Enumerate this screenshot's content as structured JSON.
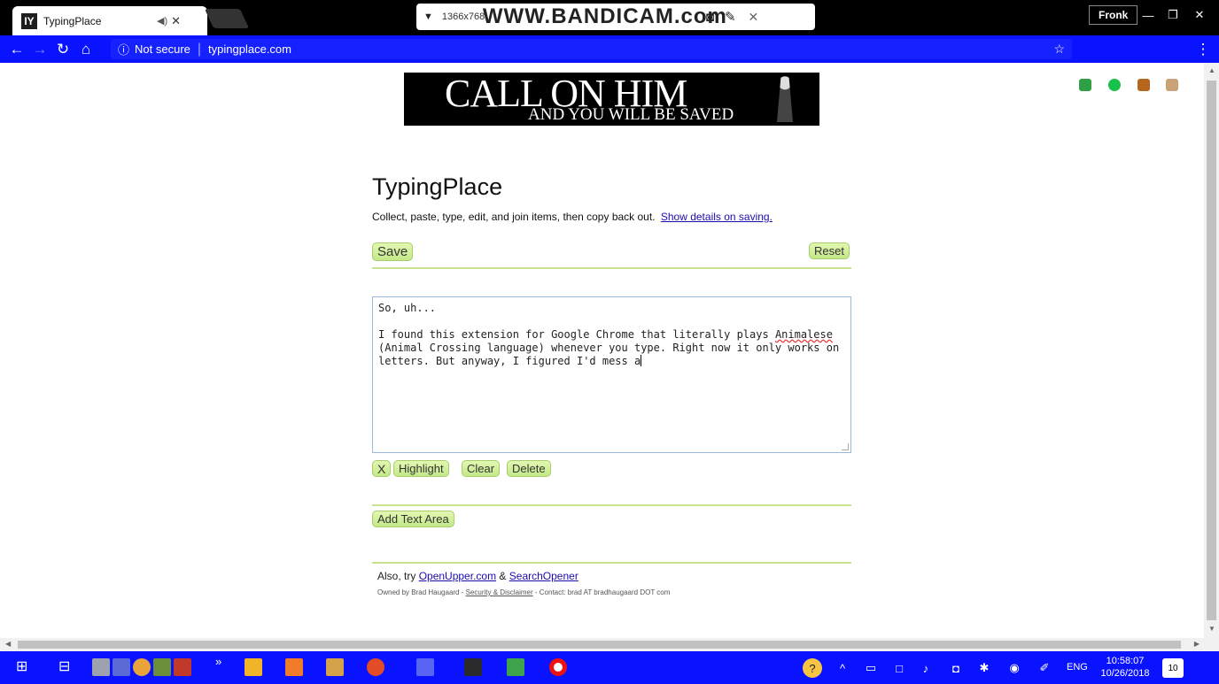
{
  "browser": {
    "tab_title": "TypingPlace",
    "tab_favicon": "IY",
    "bandicam_resolution": "1366x768",
    "bandicam_brand": "WWW.BANDICAM.com",
    "user_name": "Fronk",
    "security_label": "Not secure",
    "url": "typingplace.com"
  },
  "page": {
    "banner_line1": "CALL ON HIM",
    "banner_line2": "AND YOU WILL BE SAVED",
    "title": "TypingPlace",
    "description": "Collect, paste, type, edit, and join items, then copy back out.",
    "details_link": "Show details on saving.",
    "save_label": "Save",
    "reset_label": "Reset",
    "text_line1": "So, uh...",
    "text_before_word": "I found this extension for Google Chrome that literally plays ",
    "text_misspelled": "Animalese",
    "text_after_word": "\n(Animal Crossing language) whenever you type. Right now it only works on\nletters. But anyway, I figured I'd mess a",
    "x_label": "X",
    "highlight_label": "Highlight",
    "clear_label": "Clear",
    "delete_label": "Delete",
    "add_text_area_label": "Add Text Area",
    "also_prefix": "Also, try",
    "openupper_link": "OpenUpper.com",
    "also_amp": "&",
    "searchopener_link": "SearchOpener",
    "owned_prefix": "Owned by Brad Haugaard -",
    "security_link": "Security & Disclaimer",
    "contact_text": "- Contact: brad AT bradhaugaard DOT com"
  },
  "taskbar": {
    "language": "ENG",
    "time": "10:58:07",
    "date": "10/26/2018",
    "notification_count": "10"
  },
  "colors": {
    "accent_blue": "#0a13ff",
    "button_green": "#c3e889"
  }
}
